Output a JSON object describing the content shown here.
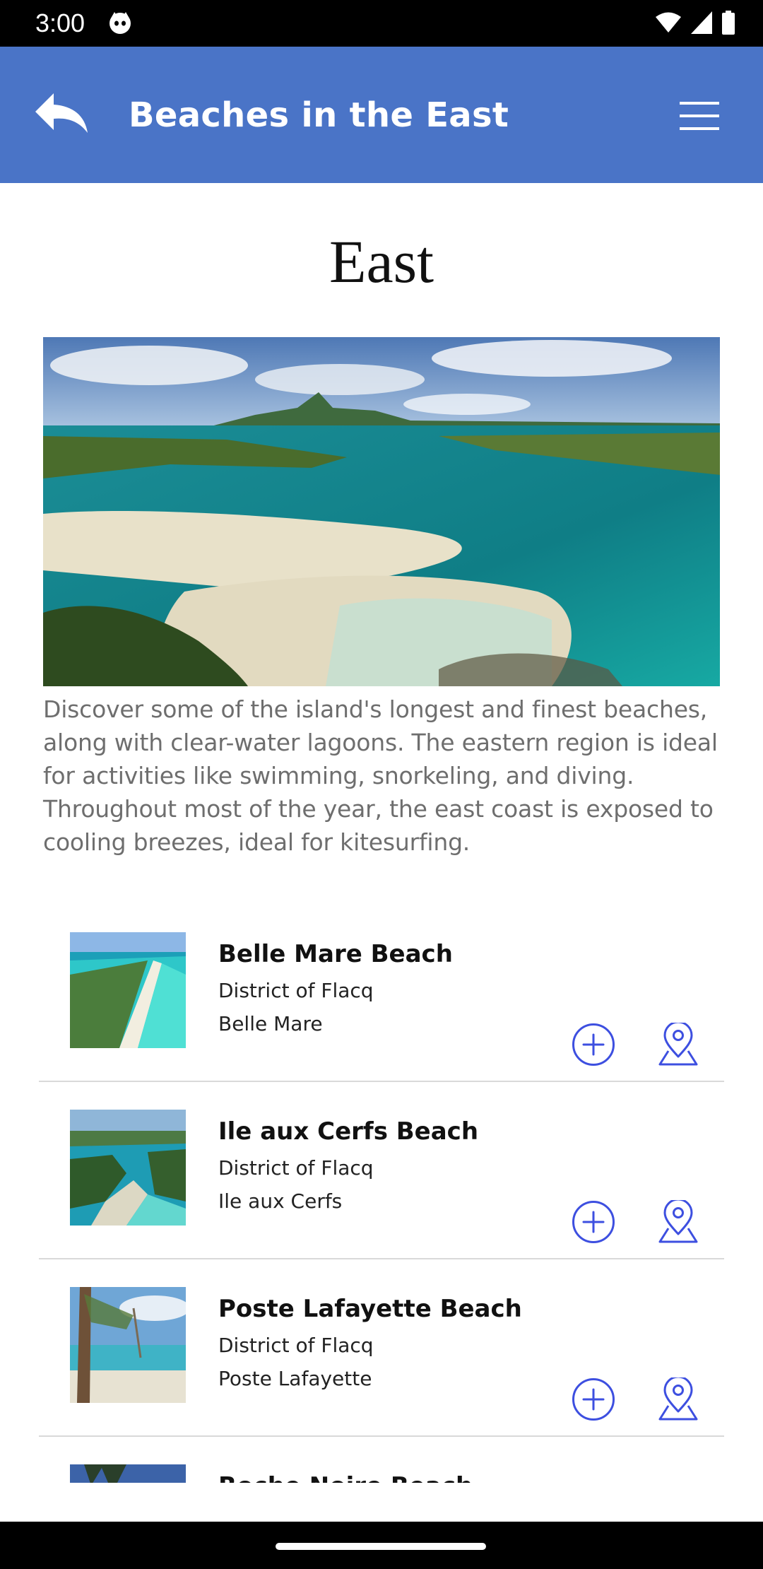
{
  "status_bar": {
    "time": "3:00"
  },
  "app_bar": {
    "title": "Beaches in the East"
  },
  "page": {
    "heading": "East",
    "description": "Discover some of the island's longest and finest beaches, along with clear-water lagoons. The eastern region is ideal for activities like swimming, snorkeling, and diving. Throughout most of the year, the east coast is exposed to cooling breezes, ideal for kitesurfing."
  },
  "beaches": [
    {
      "name": "Belle Mare Beach",
      "district": "District of Flacq",
      "area": "Belle Mare"
    },
    {
      "name": "Ile aux Cerfs Beach",
      "district": "District of Flacq",
      "area": "Ile aux Cerfs"
    },
    {
      "name": "Poste Lafayette Beach",
      "district": "District of Flacq",
      "area": "Poste Lafayette"
    },
    {
      "name": "Roche Noire Beach",
      "district": "",
      "area": ""
    }
  ],
  "icons": {
    "back": "back-arrow-icon",
    "menu": "hamburger-menu-icon",
    "add": "plus-circle-icon",
    "map": "map-pin-icon"
  },
  "colors": {
    "app_bar": "#4a74c7",
    "accent": "#3d4fe0"
  }
}
